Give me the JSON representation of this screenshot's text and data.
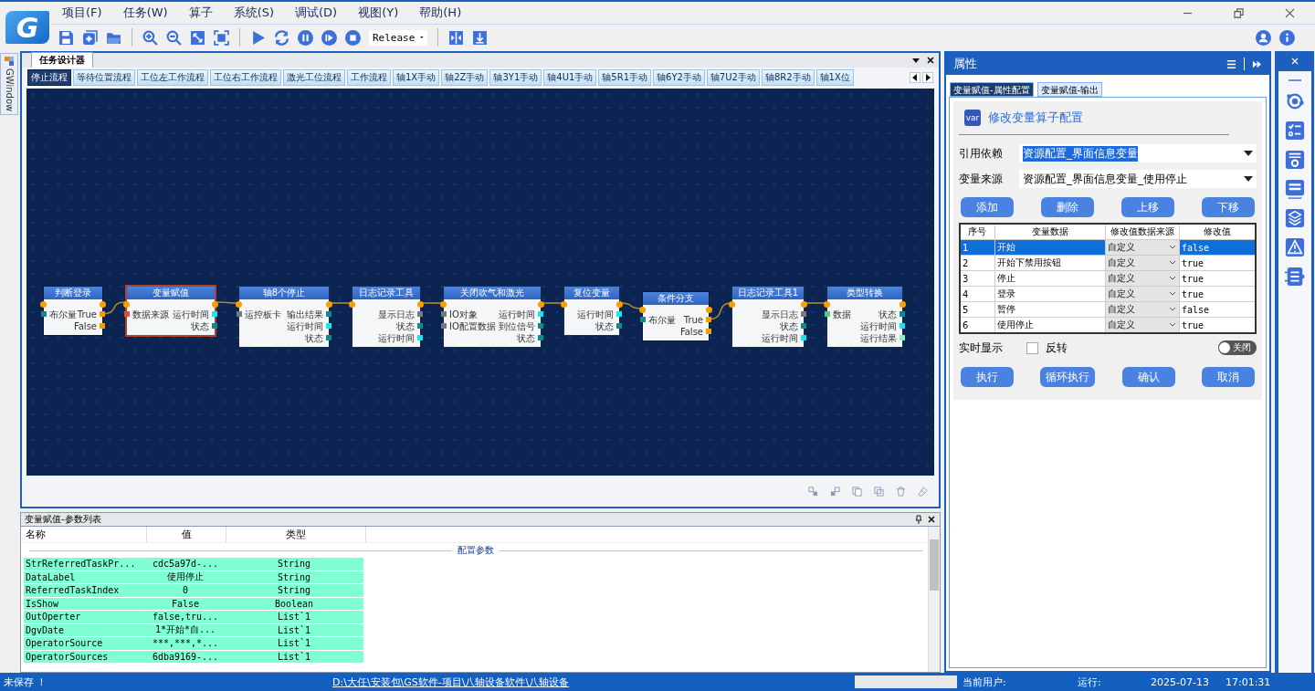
{
  "app": {
    "logo_text": "G",
    "menus": [
      "项目(F)",
      "任务(W)",
      "算子",
      "系统(S)",
      "调试(D)",
      "视图(Y)",
      "帮助(H)"
    ],
    "build_config": "Release",
    "side_tab": "GWindow"
  },
  "designer": {
    "title": "任务设计器",
    "tabs": [
      {
        "label": "停止流程",
        "selected": true
      },
      {
        "label": "等待位置流程",
        "selected": false
      },
      {
        "label": "工位左工作流程",
        "selected": false
      },
      {
        "label": "工位右工作流程",
        "selected": false
      },
      {
        "label": "激光工位流程",
        "selected": false
      },
      {
        "label": "工作流程",
        "selected": false
      },
      {
        "label": "轴1X手动",
        "selected": false
      },
      {
        "label": "轴2Z手动",
        "selected": false
      },
      {
        "label": "轴3Y1手动",
        "selected": false
      },
      {
        "label": "轴4U1手动",
        "selected": false
      },
      {
        "label": "轴5R1手动",
        "selected": false
      },
      {
        "label": "轴6Y2手动",
        "selected": false
      },
      {
        "label": "轴7U2手动",
        "selected": false
      },
      {
        "label": "轴8R2手动",
        "selected": false
      },
      {
        "label": "轴1X位",
        "selected": false
      }
    ],
    "nodes": [
      {
        "title": "判断登录",
        "kind": "branch",
        "selected": false,
        "inputs": [
          {
            "label": "布尔量",
            "color": "#138a8a"
          }
        ],
        "outputs": [
          {
            "label": "True",
            "color": "#f5a000"
          },
          {
            "label": "False",
            "color": "#f5a000"
          }
        ]
      },
      {
        "title": "变量赋值",
        "kind": "action",
        "selected": true,
        "inputs": [
          {
            "label": "数据来源",
            "color": "#e0502a"
          }
        ],
        "outputs": [
          {
            "label": "运行时间",
            "color": "#19e6f0"
          },
          {
            "label": "状态",
            "color": "#138a8a"
          }
        ]
      },
      {
        "title": "轴8个停止",
        "kind": "action",
        "selected": false,
        "inputs": [
          {
            "label": "运控板卡",
            "color": "#7a7a7a"
          }
        ],
        "outputs": [
          {
            "label": "输出结果",
            "color": "#138a8a"
          },
          {
            "label": "运行时间",
            "color": "#19e6f0"
          },
          {
            "label": "状态",
            "color": "#138a8a"
          }
        ]
      },
      {
        "title": "日志记录工具",
        "kind": "action",
        "selected": false,
        "outputs": [
          {
            "label": "显示日志",
            "color": "#7a7a7a"
          },
          {
            "label": "状态",
            "color": "#138a8a"
          },
          {
            "label": "运行时间",
            "color": "#19e6f0"
          }
        ]
      },
      {
        "title": "关闭吹气和激光",
        "kind": "action",
        "selected": false,
        "inputs": [
          {
            "label": "IO对象",
            "color": "#7a7a7a"
          },
          {
            "label": "IO配置数据",
            "color": "#7a7a7a"
          }
        ],
        "outputs": [
          {
            "label": "运行时间",
            "color": "#19e6f0"
          },
          {
            "label": "到位信号",
            "color": "#138a8a"
          },
          {
            "label": "状态",
            "color": "#138a8a"
          }
        ]
      },
      {
        "title": "复位变量",
        "kind": "action",
        "selected": false,
        "outputs": [
          {
            "label": "运行时间",
            "color": "#19e6f0"
          },
          {
            "label": "状态",
            "color": "#138a8a"
          }
        ]
      },
      {
        "title": "条件分支",
        "kind": "branch",
        "selected": false,
        "inputs": [
          {
            "label": "布尔量",
            "color": "#138a8a"
          }
        ],
        "outputs": [
          {
            "label": "True",
            "color": "#f5a000"
          },
          {
            "label": "False",
            "color": "#f5a000"
          }
        ]
      },
      {
        "title": "日志记录工具1",
        "kind": "action",
        "selected": false,
        "outputs": [
          {
            "label": "显示日志",
            "color": "#7a7a7a"
          },
          {
            "label": "状态",
            "color": "#138a8a"
          },
          {
            "label": "运行时间",
            "color": "#19e6f0"
          }
        ]
      },
      {
        "title": "类型转换",
        "kind": "action",
        "selected": false,
        "inputs": [
          {
            "label": "数据",
            "color": "#5fc48a"
          }
        ],
        "outputs": [
          {
            "label": "状态",
            "color": "#138a8a"
          },
          {
            "label": "运行时间",
            "color": "#19e6f0"
          },
          {
            "label": "运行结果",
            "color": "#8ff0c8"
          }
        ]
      }
    ]
  },
  "params_panel": {
    "title": "变量赋值-参数列表",
    "columns": [
      "名称",
      "值",
      "类型"
    ],
    "group": "配置参数",
    "rows": [
      {
        "name": "StrReferredTaskPr...",
        "value": "cdc5a97d-...",
        "type": "String"
      },
      {
        "name": "DataLabel",
        "value": "使用停止",
        "type": "String"
      },
      {
        "name": "ReferredTaskIndex",
        "value": "0",
        "type": "String"
      },
      {
        "name": "IsShow",
        "value": "False",
        "type": "Boolean"
      },
      {
        "name": "OutOperter",
        "value": "false,tru...",
        "type": "List`1"
      },
      {
        "name": "DgvDate",
        "value": "1*开始*自...",
        "type": "List`1"
      },
      {
        "name": "OperatorSource",
        "value": "***,***,*...",
        "type": "List`1"
      },
      {
        "name": "OperatorSources",
        "value": "6dba9169-...",
        "type": "List`1"
      }
    ]
  },
  "properties": {
    "title": "属性",
    "tabs": [
      {
        "label": "变量赋值-属性配置",
        "selected": true
      },
      {
        "label": "变量赋值-输出",
        "selected": false
      }
    ],
    "heading": "修改变量算子配置",
    "icon_text": "var",
    "fields": [
      {
        "label": "引用依赖",
        "value": "资源配置_界面信息变量",
        "highlighted": true
      },
      {
        "label": "变量来源",
        "value": "资源配置_界面信息变量_使用停止",
        "highlighted": false
      }
    ],
    "actions": [
      "添加",
      "删除",
      "上移",
      "下移"
    ],
    "table": {
      "columns": [
        "序号",
        "变量数据",
        "修改值数据来源",
        "修改值"
      ],
      "rows": [
        {
          "index": "1",
          "name": "开始",
          "source": "自定义",
          "value": "false",
          "selected": true
        },
        {
          "index": "2",
          "name": "开始下禁用按钮",
          "source": "自定义",
          "value": "true",
          "selected": false
        },
        {
          "index": "3",
          "name": "停止",
          "source": "自定义",
          "value": "true",
          "selected": false
        },
        {
          "index": "4",
          "name": "登录",
          "source": "自定义",
          "value": "true",
          "selected": false
        },
        {
          "index": "5",
          "name": "暂停",
          "source": "自定义",
          "value": "false",
          "selected": false
        },
        {
          "index": "6",
          "name": "使用停止",
          "source": "自定义",
          "value": "true",
          "selected": false
        }
      ]
    },
    "realtime_label": "实时显示",
    "invert": {
      "label": "反转",
      "checked": false
    },
    "toggle": {
      "label": "关闭",
      "on": false
    },
    "buttons": [
      "执行",
      "循环执行",
      "确认",
      "取消"
    ]
  },
  "status_bar": {
    "save_state": "未保存 ！",
    "path": "D:\\大任\\安装包\\GS软件-项目\\八轴设备软件\\八轴设备",
    "user_label": "当前用户:",
    "run_label": "运行:",
    "date": "2025-07-13",
    "time": "17:01:31"
  }
}
